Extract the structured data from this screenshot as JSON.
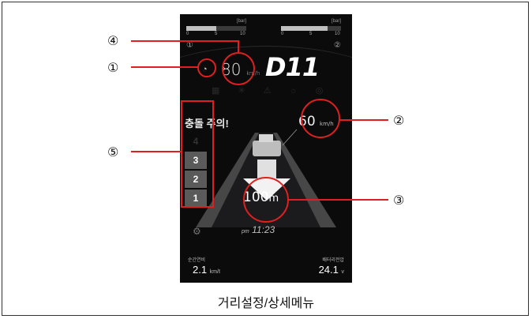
{
  "caption": "거리설정/상세메뉴",
  "callouts": [
    "①",
    "②",
    "③",
    "④",
    "⑤"
  ],
  "dashboard": {
    "gauges": [
      {
        "unit": "[bar]",
        "ticks": [
          "0",
          "5",
          "10"
        ],
        "index": "①",
        "fill_percent": 50
      },
      {
        "unit": "[bar]",
        "ticks": [
          "0",
          "5",
          "10"
        ],
        "index": "②",
        "fill_percent": 78
      }
    ],
    "speed_set": {
      "value": "80",
      "unit": "km/h"
    },
    "model": "D11",
    "warning": "충돌 주의!",
    "gears": [
      "4",
      "3",
      "2",
      "1"
    ],
    "target_speed": {
      "value": "60",
      "unit": "km/h"
    },
    "distance": {
      "value": "100",
      "unit": "m"
    },
    "clock": {
      "ampm": "pm",
      "time": "11:23"
    },
    "fuel": {
      "label": "순간연비",
      "value": "2.1",
      "unit": "km/ℓ"
    },
    "battery": {
      "label": "배터리전압",
      "value": "24.1",
      "unit": "v"
    },
    "colors": {
      "callout": "#e02020",
      "screen_bg": "#0b0b0c"
    }
  }
}
